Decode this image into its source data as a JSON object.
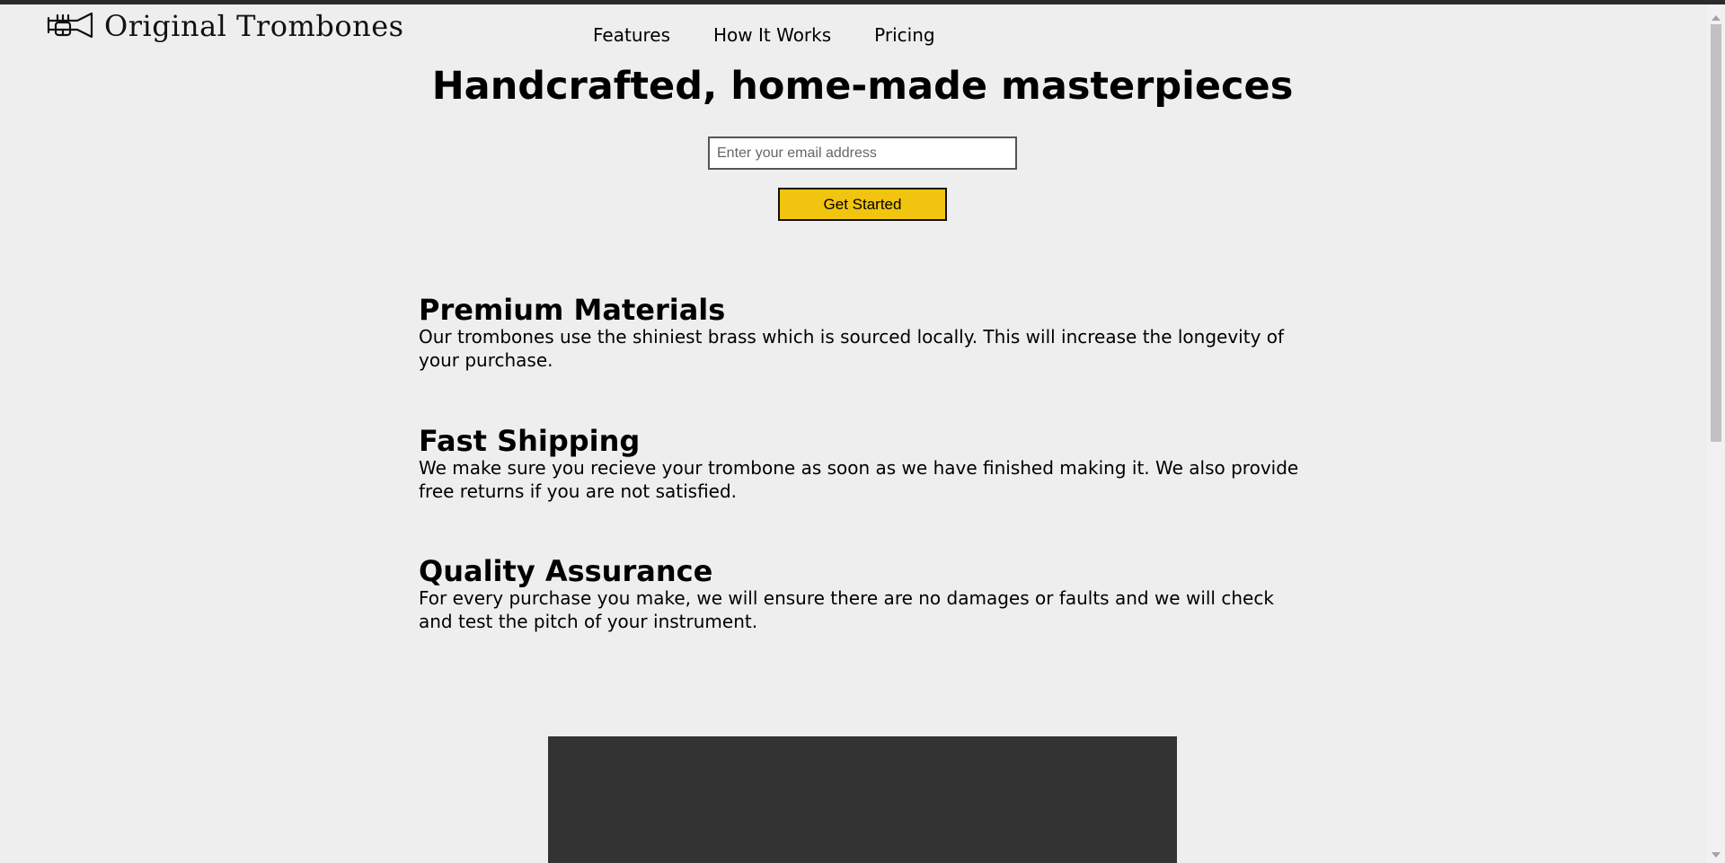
{
  "header": {
    "logo_text": "Original Trombones",
    "logo_icon": "trumpet-icon",
    "nav": [
      {
        "label": "Features"
      },
      {
        "label": "How It Works"
      },
      {
        "label": "Pricing"
      }
    ]
  },
  "hero": {
    "title": "Handcrafted, home-made masterpieces",
    "email_placeholder": "Enter your email address",
    "email_value": "",
    "cta_label": "Get Started"
  },
  "features": [
    {
      "title": "Premium Materials",
      "description": "Our trombones use the shiniest brass which is sourced locally. This will increase the longevity of your purchase."
    },
    {
      "title": "Fast Shipping",
      "description": "We make sure you recieve your trombone as soon as we have finished making it. We also provide free returns if you are not satisfied."
    },
    {
      "title": "Quality Assurance",
      "description": "For every purchase you make, we will ensure there are no damages or faults and we will check and test the pitch of your instrument."
    }
  ],
  "colors": {
    "background": "#eeeeee",
    "accent": "#f1c40f",
    "video_block": "#333333"
  }
}
